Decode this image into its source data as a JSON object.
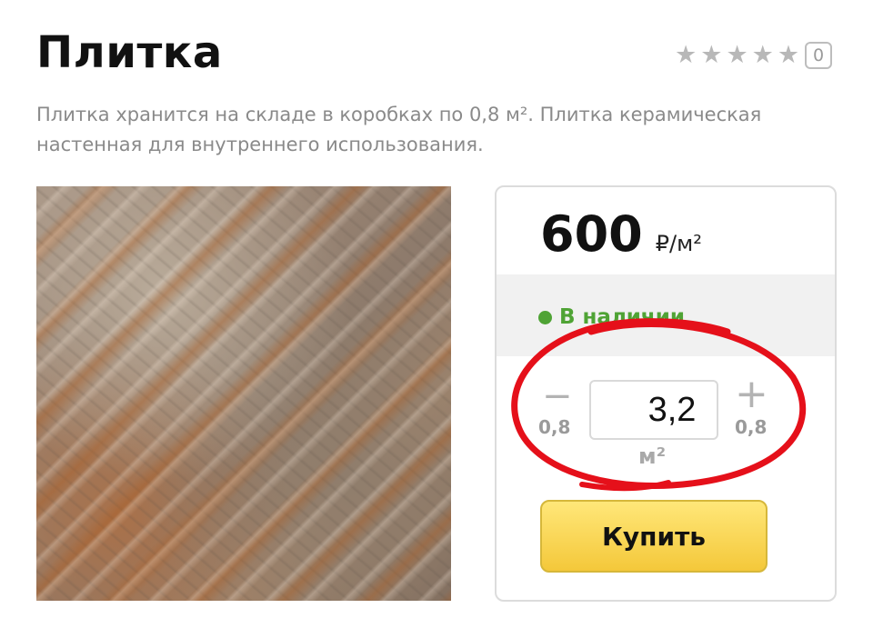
{
  "product": {
    "title": "Плитка",
    "description": "Плитка хранится на складе в коробках по 0,8 м². Плитка керамическая настенная для внутреннего использования.",
    "rating": {
      "stars_filled": 0,
      "stars_total": 5,
      "reviews_count": "0"
    },
    "image": {
      "alt": "Керамическая плитка под камень"
    }
  },
  "purchase": {
    "price": "600",
    "price_unit": "₽/м²",
    "stock_status": "В наличии",
    "quantity": {
      "value": "3,2",
      "unit": "м²",
      "minus_symbol": "−",
      "plus_symbol": "+",
      "step_left": "0,8",
      "step_right": "0,8"
    },
    "buy_label": "Купить"
  },
  "colors": {
    "stock_green": "#4fa335",
    "button_yellow": "#f4c83a",
    "annotation_red": "#e5101a"
  },
  "icons": {
    "star": "star-icon",
    "stock": "stock-dot-icon"
  }
}
